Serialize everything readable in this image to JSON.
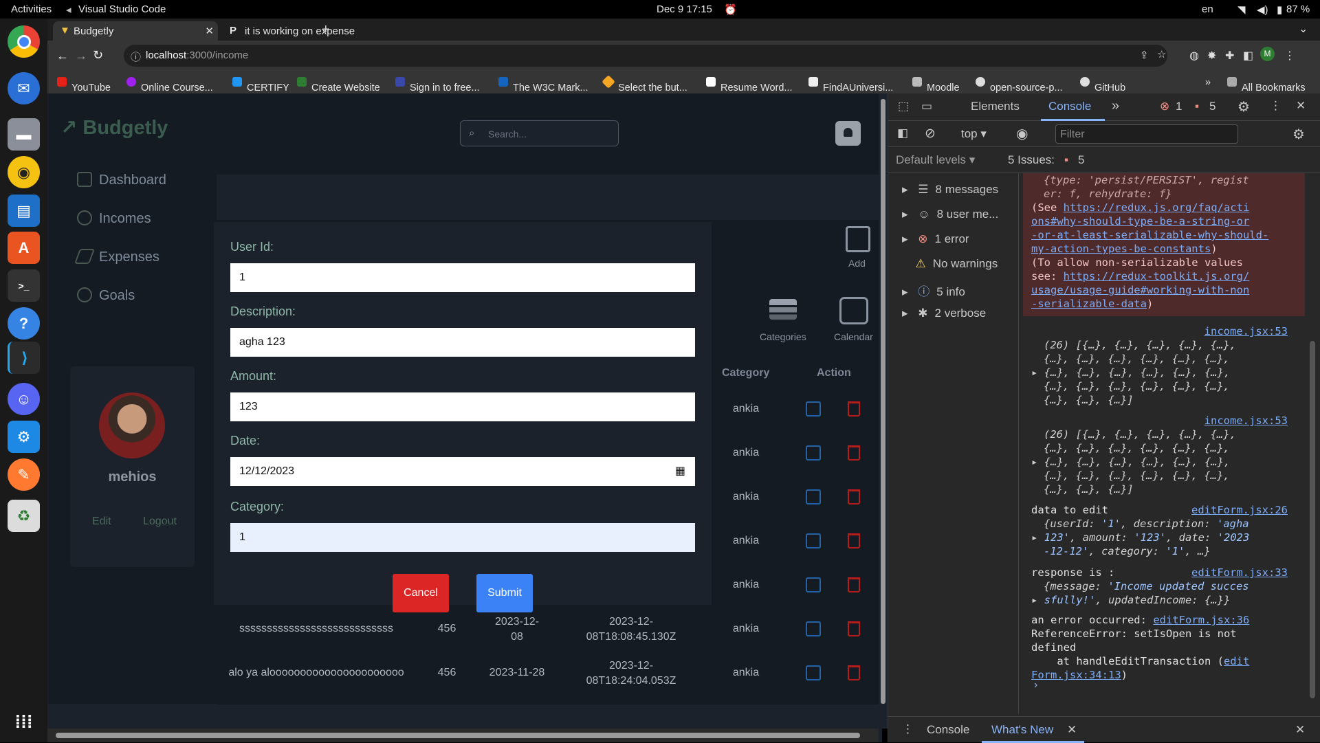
{
  "system": {
    "activities": "Activities",
    "app_name": "Visual Studio Code",
    "datetime": "Dec 9  17:15",
    "lang": "en",
    "battery": "87 %"
  },
  "browser": {
    "tabs": [
      {
        "label": "Budgetly"
      },
      {
        "label": "it is working on expense"
      }
    ],
    "url_host": "localhost",
    "url_path": ":3000/income",
    "bookmarks": [
      "YouTube",
      "Online Course...",
      "CERTIFY",
      "Create Website",
      "Sign in to free...",
      "The W3C Mark...",
      "Select the but...",
      "Resume Word...",
      "FindAUniversi...",
      "Moodle",
      "open-source-p...",
      "GitHub"
    ],
    "all_bookmarks": "All Bookmarks",
    "profile_initial": "M"
  },
  "app": {
    "brand": "Budgetly",
    "nav": [
      "Dashboard",
      "Incomes",
      "Expenses",
      "Goals"
    ],
    "search_placeholder": "Search...",
    "user_name": "mehios",
    "edit": "Edit",
    "logout": "Logout",
    "add": "Add",
    "categories": "Categories",
    "calendar": "Calendar",
    "table_headers": {
      "category": "Category",
      "action": "Action"
    },
    "rows": [
      {
        "desc": "",
        "amount": "",
        "date": "",
        "created": "",
        "category": "ankia"
      },
      {
        "desc": "",
        "amount": "",
        "date": "",
        "created": "",
        "category": "ankia"
      },
      {
        "desc": "",
        "amount": "",
        "date": "",
        "created": "",
        "category": "ankia"
      },
      {
        "desc": "",
        "amount": "",
        "date": "",
        "created": "",
        "category": "ankia"
      },
      {
        "desc": "",
        "amount": "",
        "date": "",
        "created": "",
        "category": "ankia"
      },
      {
        "desc": "ssssssssssssssssssssssssssss",
        "amount": "456",
        "date": "2023-12-08",
        "created": "2023-12-08T18:08:45.130Z",
        "category": "ankia"
      },
      {
        "desc": "alo ya aloooooooooooooooooooooo",
        "amount": "456",
        "date": "2023-11-28",
        "created": "2023-12-08T18:24:04.053Z",
        "category": "ankia"
      }
    ]
  },
  "modal": {
    "user_id_label": "User Id:",
    "user_id": "1",
    "description_label": "Description:",
    "description": "agha 123",
    "amount_label": "Amount:",
    "amount": "123",
    "date_label": "Date:",
    "date": "12/12/2023",
    "category_label": "Category:",
    "category": "1",
    "cancel": "Cancel",
    "submit": "Submit"
  },
  "devtools": {
    "tabs": [
      "Elements",
      "Console"
    ],
    "error_count": "1",
    "issue_count": "5",
    "context": "top",
    "filter_placeholder": "Filter",
    "levels": "Default levels",
    "issues": "5 Issues:",
    "issues_count": "5",
    "sidebar": [
      "8 messages",
      "8 user me...",
      "1 error",
      "No warnings",
      "5 info",
      "2 verbose"
    ],
    "bottom_tabs": [
      "Console",
      "What's New"
    ]
  }
}
